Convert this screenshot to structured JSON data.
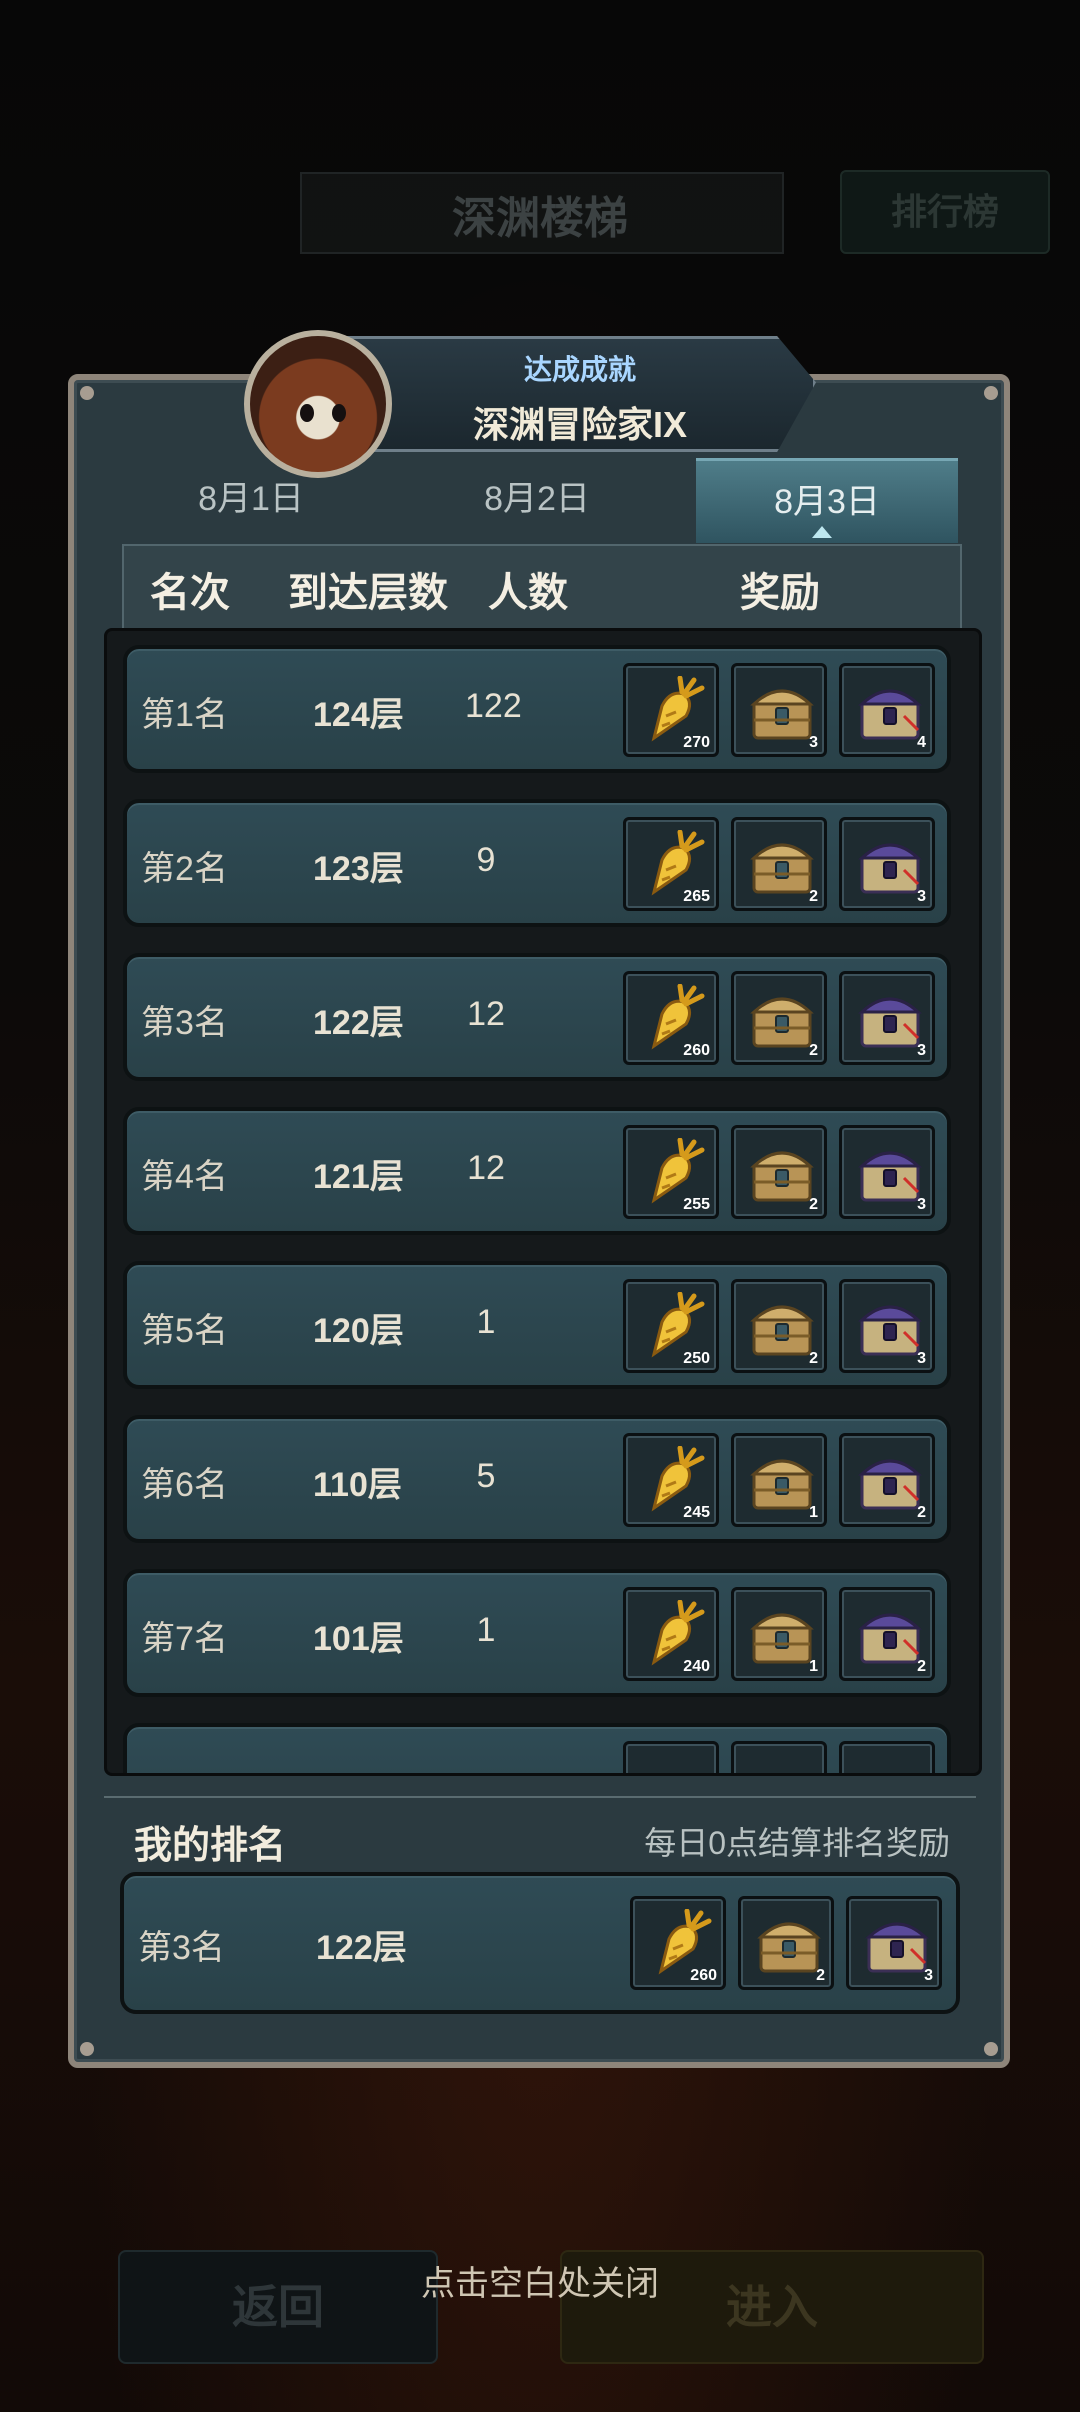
{
  "background": {
    "title": "深渊楼梯",
    "leaderboard_button": "排行榜",
    "back_button": "返回",
    "enter_button": "进入",
    "close_hint": "点击空白处关闭"
  },
  "achievement": {
    "label": "达成成就",
    "title": "深渊冒险家IX"
  },
  "tabs": [
    {
      "label": "8月1日",
      "active": false
    },
    {
      "label": "8月2日",
      "active": false
    },
    {
      "label": "8月3日",
      "active": true
    }
  ],
  "table": {
    "headers": {
      "rank": "名次",
      "floor": "到达层数",
      "count": "人数",
      "reward": "奖励"
    },
    "rows": [
      {
        "rank": "第1名",
        "floor": "124层",
        "count": "122",
        "rewards": [
          "270",
          "3",
          "4"
        ]
      },
      {
        "rank": "第2名",
        "floor": "123层",
        "count": "9",
        "rewards": [
          "265",
          "2",
          "3"
        ]
      },
      {
        "rank": "第3名",
        "floor": "122层",
        "count": "12",
        "rewards": [
          "260",
          "2",
          "3"
        ]
      },
      {
        "rank": "第4名",
        "floor": "121层",
        "count": "12",
        "rewards": [
          "255",
          "2",
          "3"
        ]
      },
      {
        "rank": "第5名",
        "floor": "120层",
        "count": "1",
        "rewards": [
          "250",
          "2",
          "3"
        ]
      },
      {
        "rank": "第6名",
        "floor": "110层",
        "count": "5",
        "rewards": [
          "245",
          "1",
          "2"
        ]
      },
      {
        "rank": "第7名",
        "floor": "101层",
        "count": "1",
        "rewards": [
          "240",
          "1",
          "2"
        ]
      }
    ]
  },
  "my_rank": {
    "title": "我的排名",
    "note": "每日0点结算排名奖励",
    "rank": "第3名",
    "floor": "122层",
    "rewards": [
      "260",
      "2",
      "3"
    ]
  },
  "icons": {
    "reward_1": "golden-carrot-icon",
    "reward_2": "gold-chest-icon",
    "reward_3": "purple-chest-icon"
  },
  "colors": {
    "panel_bg": "#2b3a40",
    "row_bg": "#2f4b55",
    "active_tab": "#4f7d89",
    "achievement_label": "#a9d6ff"
  }
}
